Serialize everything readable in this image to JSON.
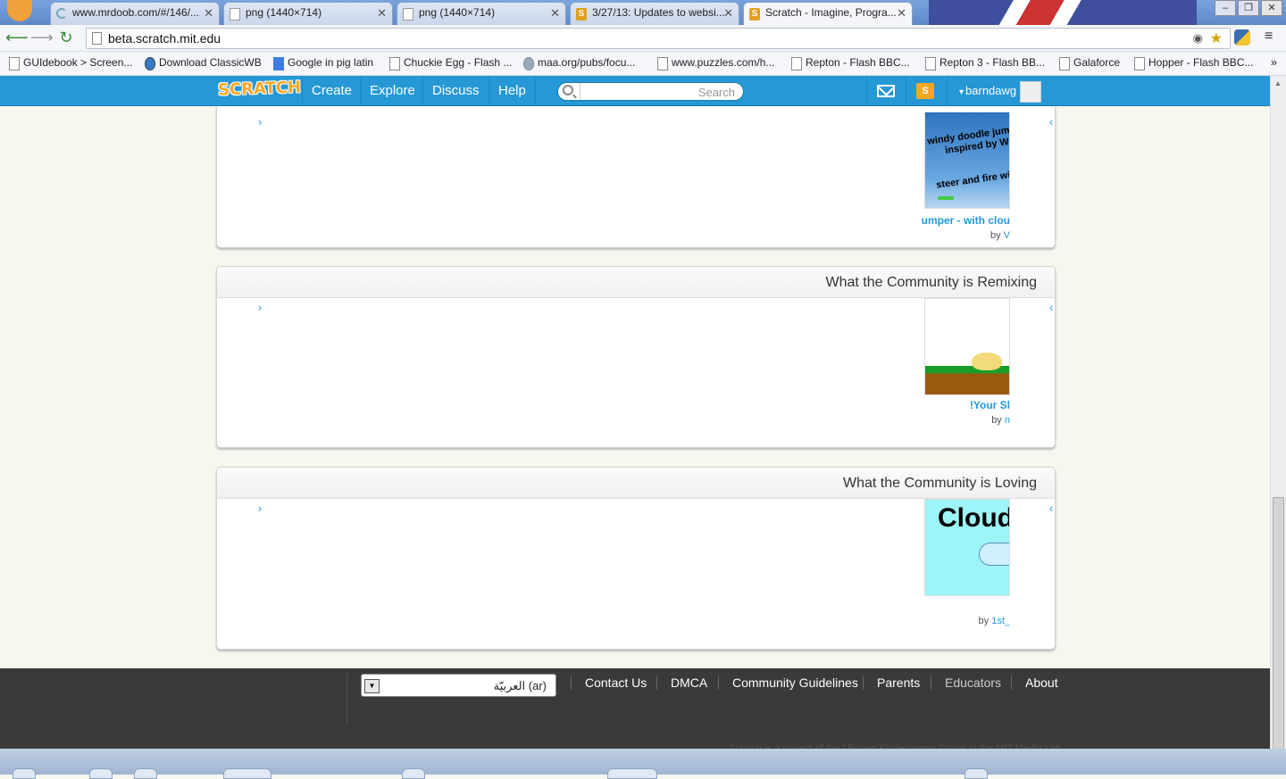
{
  "browser": {
    "tabs": [
      {
        "title": "www.mrdoob.com/#/146/..."
      },
      {
        "title": "png (1440×714)"
      },
      {
        "title": "png (1440×714)"
      },
      {
        "title": "3/27/13: Updates to websi..."
      },
      {
        "title": "Scratch - Imagine, Progra..."
      }
    ],
    "url": "beta.scratch.mit.edu",
    "bookmarks": [
      "GUIdebook > Screen...",
      "Download ClassicWB",
      "Google in pig latin",
      "Chuckie Egg - Flash ...",
      "maa.org/pubs/focu...",
      "www.puzzles.com/h...",
      "Repton - Flash BBC...",
      "Repton 3 - Flash BB...",
      "Galaforce",
      "Hopper - Flash BBC..."
    ],
    "bookmarks_more": "»"
  },
  "header": {
    "logo": "SCRATCH",
    "nav": [
      "Create",
      "Explore",
      "Discuss",
      "Help"
    ],
    "search_placeholder": "Search",
    "mystuff_glyph": "S",
    "username": "barndawg"
  },
  "sections": [
    {
      "title": "",
      "project_title": "umper - with clou",
      "by_label": "by",
      "author": "V",
      "thumb_lines": [
        "windy doodle jump",
        "inspired by W",
        "steer and fire wi"
      ]
    },
    {
      "title": "What the Community is Remixing",
      "project_title": "!Your Sl",
      "by_label": "by",
      "author": "n"
    },
    {
      "title": "What the Community is Loving",
      "project_title": "",
      "by_label": "by",
      "author": "1st_",
      "thumb_text": "Cloud"
    }
  ],
  "arrows": {
    "next": "›",
    "prev": "‹"
  },
  "footer": {
    "language": "العربيّة (ar)",
    "links": [
      "Contact Us",
      "DMCA",
      "Community Guidelines",
      "Parents",
      "Educators",
      "About"
    ],
    "credit": "Scratch is a project of the Lifelong Kindergarten Group at the MIT Media Lab"
  },
  "colors": {
    "scratch_blue": "#2598d5",
    "logo_orange": "#f7a823",
    "footer": "#3a3a3a"
  }
}
